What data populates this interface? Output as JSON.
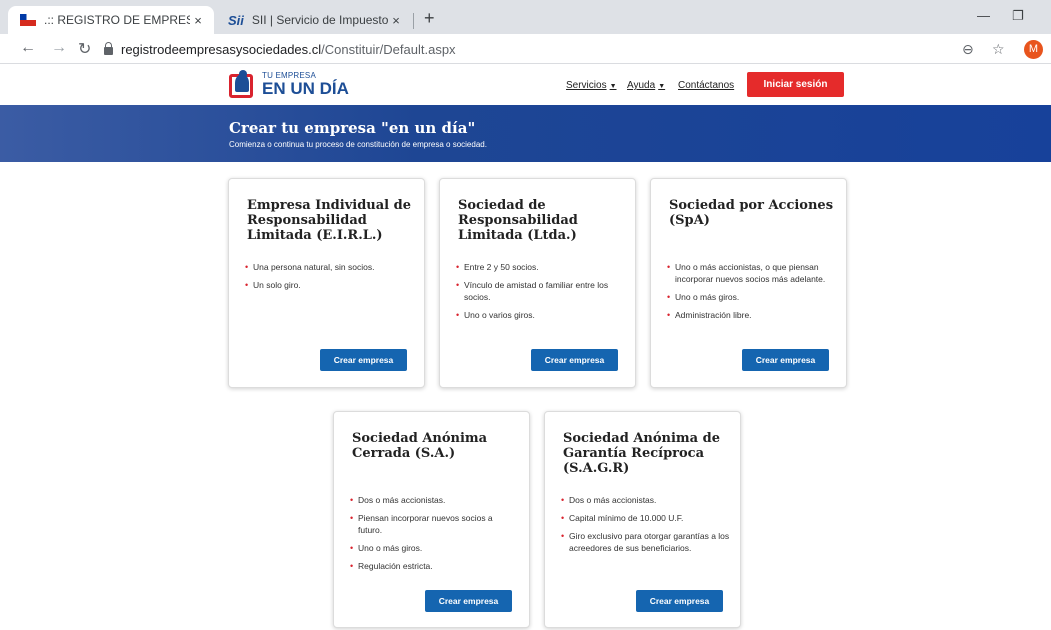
{
  "browser": {
    "tabs": [
      {
        "title": ".:: REGISTRO DE EMPRESAS Y SOCI",
        "active": true
      },
      {
        "title": "SII | Servicio de Impuestos Intern",
        "active": false
      }
    ],
    "close_glyph": "×",
    "new_tab_glyph": "+",
    "minimize_glyph": "—",
    "restore_glyph": "❐",
    "url_host": "registrodeempresasysociedades.cl",
    "url_path": "/Constituir/Default.aspx",
    "profile_initial": "M",
    "accent_profile": "#e8541d"
  },
  "header": {
    "logo_small": "TU EMPRESA",
    "logo_big": "EN UN DÍA",
    "nav": {
      "servicios": "Servicios",
      "ayuda": "Ayuda",
      "contactanos": "Contáctanos"
    },
    "login_label": "Iniciar sesión",
    "login_color": "#e52b2b"
  },
  "banner": {
    "title": "Crear tu empresa \"en un día\"",
    "subtitle": "Comienza o continua tu proceso de constitución de empresa o sociedad."
  },
  "cards": [
    {
      "title": "Empresa Individual de Responsabilidad Limitada (E.I.R.L.)",
      "items": [
        "Una persona natural, sin socios.",
        "Un solo giro."
      ],
      "button": "Crear empresa"
    },
    {
      "title": "Sociedad de Responsabilidad Limitada (Ltda.)",
      "items": [
        "Entre 2 y 50 socios.",
        "Vínculo de amistad o familiar entre los socios.",
        "Uno o varios giros."
      ],
      "button": "Crear empresa"
    },
    {
      "title": "Sociedad por Acciones (SpA)",
      "items": [
        "Uno o más accionistas, o que piensan incorporar nuevos socios más adelante.",
        "Uno o más giros.",
        "Administración libre."
      ],
      "button": "Crear empresa"
    },
    {
      "title": "Sociedad Anónima Cerrada (S.A.)",
      "items": [
        "Dos o más accionistas.",
        "Piensan incorporar nuevos socios a futuro.",
        "Uno o más giros.",
        "Regulación estricta."
      ],
      "button": "Crear empresa"
    },
    {
      "title": "Sociedad Anónima de Garantía Recíproca (S.A.G.R)",
      "items": [
        "Dos o más accionistas.",
        "Capital mínimo de 10.000 U.F.",
        "Giro exclusivo para otorgar garantías a los acreedores de sus beneficiarios."
      ],
      "button": "Crear empresa"
    }
  ],
  "colors": {
    "brand_blue": "#1d4e96",
    "button_blue": "#1565b0",
    "bullet_red": "#d9232e"
  }
}
